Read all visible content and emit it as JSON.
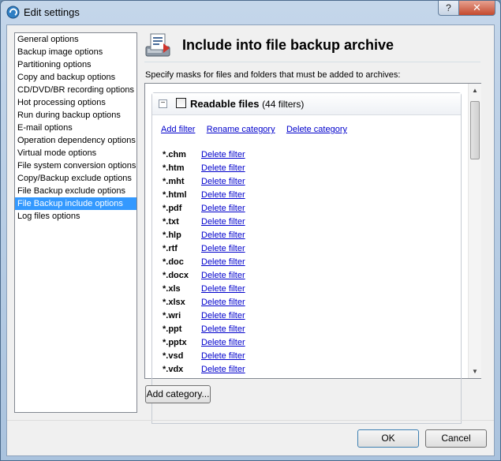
{
  "window": {
    "title": "Edit settings",
    "help_label": "?",
    "close_label": "✕"
  },
  "sidebar": {
    "items": [
      {
        "label": "General options"
      },
      {
        "label": "Backup image options"
      },
      {
        "label": "Partitioning options"
      },
      {
        "label": "Copy and backup options"
      },
      {
        "label": "CD/DVD/BR recording options"
      },
      {
        "label": "Hot processing options"
      },
      {
        "label": "Run during backup options"
      },
      {
        "label": "E-mail options"
      },
      {
        "label": "Operation dependency options"
      },
      {
        "label": "Virtual mode options"
      },
      {
        "label": "File system conversion options"
      },
      {
        "label": "Copy/Backup exclude options"
      },
      {
        "label": "File Backup exclude options"
      },
      {
        "label": "File Backup include options",
        "selected": true
      },
      {
        "label": "Log files options"
      }
    ]
  },
  "page": {
    "title": "Include into file backup archive",
    "description": "Specify masks for  files and folders that must be added to archives:"
  },
  "category": {
    "name": "Readable files",
    "count": "(44 filters)",
    "collapse_symbol": "−",
    "actions": {
      "add_filter": "Add filter",
      "rename_category": "Rename category",
      "delete_category": "Delete category"
    },
    "delete_label": "Delete filter",
    "filters": [
      "*.chm",
      "*.htm",
      "*.mht",
      "*.html",
      "*.pdf",
      "*.txt",
      "*.hlp",
      "*.rtf",
      "*.doc",
      "*.docx",
      "*.xls",
      "*.xlsx",
      "*.wri",
      "*.ppt",
      "*.pptx",
      "*.vsd",
      "*.vdx"
    ]
  },
  "buttons": {
    "add_category": "Add category...",
    "ok": "OK",
    "cancel": "Cancel"
  },
  "colors": {
    "selection": "#3399ff",
    "link": "#0000cc",
    "close_button": "#c44a2e"
  }
}
